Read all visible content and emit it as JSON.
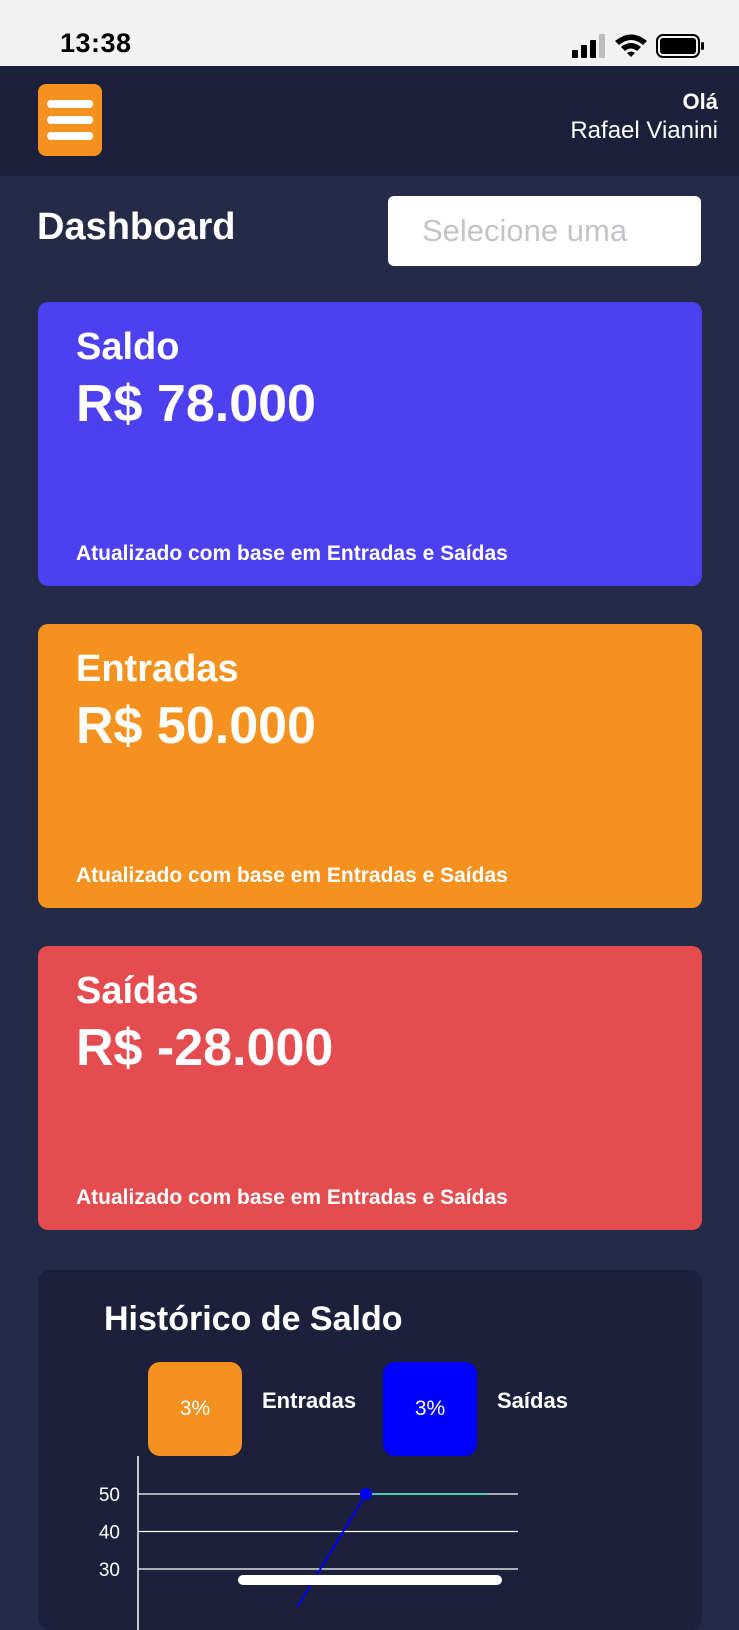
{
  "status_bar": {
    "time": "13:38",
    "icons": [
      "signal-icon",
      "wifi-icon",
      "battery-icon"
    ]
  },
  "header": {
    "menu_icon": "hamburger-menu-icon",
    "greeting": "Olá",
    "user_name": "Rafael Vianini"
  },
  "page": {
    "title": "Dashboard",
    "month_select_placeholder": "Selecione uma",
    "month_select_value": ""
  },
  "cards": [
    {
      "title": "Saldo",
      "value": "R$ 78.000",
      "footer": "Atualizado com base em Entradas e Saídas",
      "color": "#4c40f0"
    },
    {
      "title": "Entradas",
      "value": "R$ 50.000",
      "footer": "Atualizado com base em Entradas e Saídas",
      "color": "#f5921f"
    },
    {
      "title": "Saídas",
      "value": "R$ -28.000",
      "footer": "Atualizado com base em Entradas e Saídas",
      "color": "#e54c50"
    }
  ],
  "history": {
    "title": "Histórico de Saldo",
    "legend": [
      {
        "percent": "3%",
        "label": "Entradas",
        "color": "#f5921f"
      },
      {
        "percent": "3%",
        "label": "Saídas",
        "color": "#0000ff"
      }
    ]
  },
  "chart_data": {
    "type": "line",
    "title": "Histórico de Saldo",
    "ylim": [
      20,
      50
    ],
    "y_ticks": [
      50,
      40,
      30
    ],
    "grid": true,
    "series": [
      {
        "name": "Saídas",
        "color": "#0000ff",
        "points": [
          [
            0.42,
            20
          ],
          [
            0.6,
            50
          ]
        ]
      },
      {
        "name": "Entradas",
        "color": "#4ec9b0",
        "points": [
          [
            0.6,
            50
          ],
          [
            0.92,
            50
          ]
        ]
      }
    ]
  }
}
